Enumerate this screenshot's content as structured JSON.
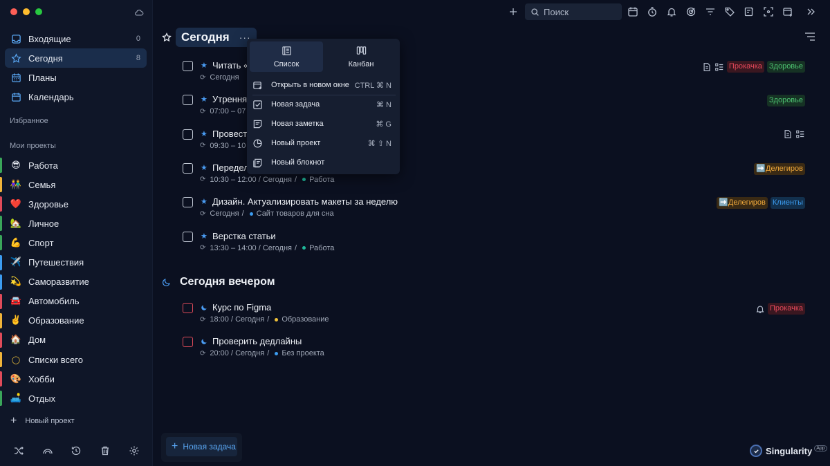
{
  "sidebar": {
    "nav": [
      {
        "label": "Входящие",
        "count": "0",
        "icon": "inbox-icon"
      },
      {
        "label": "Сегодня",
        "count": "8",
        "icon": "star-icon"
      },
      {
        "label": "Планы",
        "count": "",
        "icon": "calendar-grid-icon"
      },
      {
        "label": "Календарь",
        "count": "",
        "icon": "calendar-icon"
      }
    ],
    "favorites_label": "Избранное",
    "projects_label": "Мои проекты",
    "projects": [
      {
        "emoji": "😎",
        "label": "Работа",
        "color": "#3aa65a"
      },
      {
        "emoji": "👫",
        "label": "Семья",
        "color": "#f0b43a"
      },
      {
        "emoji": "❤️",
        "label": "Здоровье",
        "color": "#e04b5a"
      },
      {
        "emoji": "🏡",
        "label": "Личное",
        "color": "#3aa65a"
      },
      {
        "emoji": "💪",
        "label": "Спорт",
        "color": "#3aa65a"
      },
      {
        "emoji": "✈️",
        "label": "Путешествия",
        "color": "#3c9cf0"
      },
      {
        "emoji": "💫",
        "label": "Саморазвитие",
        "color": "#3c9cf0"
      },
      {
        "emoji": "🚘",
        "label": "Автомобиль",
        "color": "#e04b5a"
      },
      {
        "emoji": "✌️",
        "label": "Образование",
        "color": "#f0b43a"
      },
      {
        "emoji": "🏠",
        "label": "Дом",
        "color": "#e04b5a"
      },
      {
        "emoji": "◯",
        "label": "Списки всего",
        "color": "#f0b43a"
      },
      {
        "emoji": "🎨",
        "label": "Хобби",
        "color": "#e04b5a"
      },
      {
        "emoji": "🛋️",
        "label": "Отдых",
        "color": "#3aa65a"
      }
    ],
    "new_project": "Новый проект"
  },
  "topbar": {
    "search_placeholder": "Поиск"
  },
  "main": {
    "heading": "Сегодня",
    "heading_more": "···",
    "tasks": [
      {
        "title": "Читать «",
        "meta_time": "Сегодня",
        "project": "",
        "project_color": "",
        "tags": [
          {
            "text": "Прокачка",
            "style": "red"
          },
          {
            "text": "Здоровье",
            "style": "green"
          }
        ],
        "icons": [
          "note-icon",
          "checklist-icon"
        ]
      },
      {
        "title": "Утренняя",
        "meta_time": "07:00 – 07",
        "project": "",
        "project_color": "",
        "tags": [
          {
            "text": "Здоровье",
            "style": "green"
          }
        ],
        "icons": []
      },
      {
        "title": "Провест",
        "meta_time": "09:30 – 10",
        "project": "",
        "project_color": "",
        "tags": [],
        "icons": [
          "note-icon",
          "checklist-icon"
        ]
      },
      {
        "title": "Передел",
        "meta_time": "10:30 – 12:00 / Сегодня",
        "project": "Работа",
        "project_color": "#1fb79a",
        "tags": [
          {
            "text": "➡️Делегиров",
            "style": "orange"
          }
        ],
        "icons": []
      },
      {
        "title": "Дизайн. Актуализировать макеты за неделю",
        "meta_time": "Сегодня",
        "project": "Сайт товаров для сна",
        "project_color": "#3c9cf0",
        "tags": [
          {
            "text": "➡️Делегиров",
            "style": "orange"
          },
          {
            "text": "Клиенты",
            "style": "blue"
          }
        ],
        "icons": []
      },
      {
        "title": "Верстка статьи",
        "meta_time": "13:30 – 14:00 / Сегодня",
        "project": "Работа",
        "project_color": "#1fb79a",
        "tags": [],
        "icons": []
      }
    ],
    "evening_heading": "Сегодня вечером",
    "evening_tasks": [
      {
        "title": "Курс по Figma",
        "meta_time": "18:00 / Сегодня",
        "project": "Образование",
        "project_color": "#f0c23a",
        "tags": [
          {
            "text": "Прокачка",
            "style": "red"
          }
        ],
        "icons": [
          "bell-icon"
        ]
      },
      {
        "title": "Проверить дедлайны",
        "meta_time": "20:00 / Сегодня",
        "project": "Без проекта",
        "project_color": "#3c9cf0",
        "tags": [],
        "icons": []
      }
    ],
    "new_task": "Новая задача"
  },
  "popup": {
    "views": [
      {
        "label": "Список",
        "icon": "list-view-icon"
      },
      {
        "label": "Канбан",
        "icon": "kanban-icon"
      }
    ],
    "items": [
      {
        "label": "Открыть в новом окне",
        "shortcut": "CTRL ⌘ N",
        "icon": "new-window-icon"
      },
      {
        "label": "Новая задача",
        "shortcut": "⌘ N",
        "icon": "task-check-icon"
      },
      {
        "label": "Новая заметка",
        "shortcut": "⌘ G",
        "icon": "note-icon"
      },
      {
        "label": "Новый проект",
        "shortcut": "⌘ ⇧ N",
        "icon": "project-circle-icon"
      },
      {
        "label": "Новый блокнот",
        "shortcut": "",
        "icon": "notebook-icon"
      }
    ]
  },
  "brand": {
    "name": "Singularity",
    "badge": "App"
  },
  "colors": {
    "accent": "#4a9cf3",
    "bg": "#0b1020",
    "sidebar": "#0f1628"
  }
}
